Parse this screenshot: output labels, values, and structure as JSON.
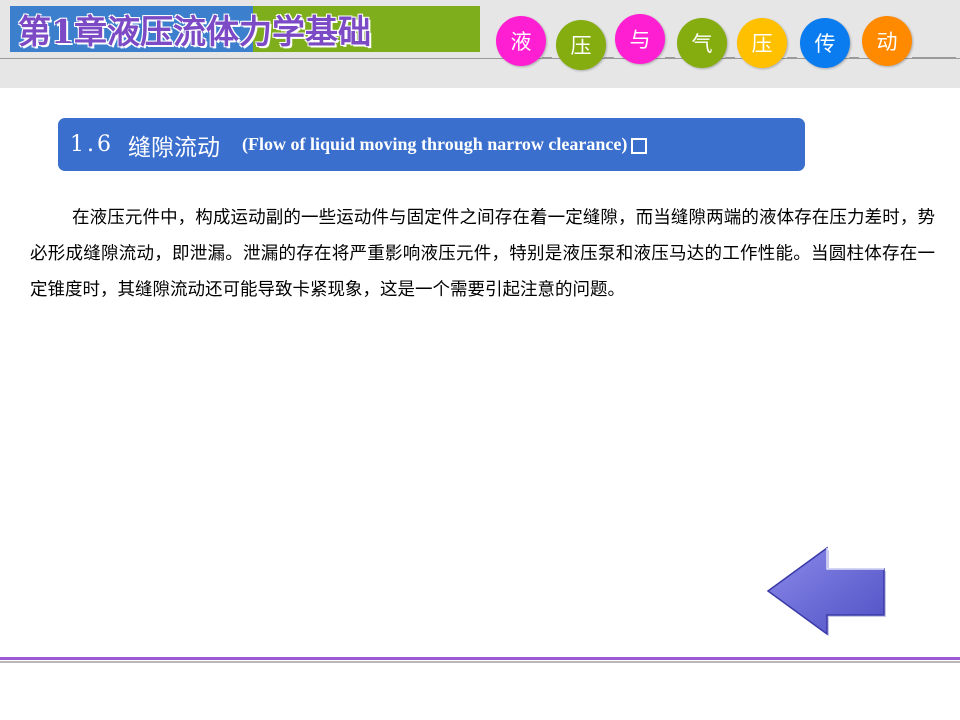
{
  "header": {
    "chapter_label": "第1章",
    "chapter_title": "液压流体力学基础",
    "course_chars": [
      {
        "char": "液",
        "color": "#ff1fd2"
      },
      {
        "char": "压",
        "color": "#85ad10"
      },
      {
        "char": "与",
        "color": "#ff1fd2"
      },
      {
        "char": "气",
        "color": "#85ad10"
      },
      {
        "char": "压",
        "color": "#ffc000"
      },
      {
        "char": "传",
        "color": "#0a7cf0"
      },
      {
        "char": "动",
        "color": "#ff8a00"
      }
    ]
  },
  "section": {
    "number": "1.6",
    "title_cn": "缝隙流动",
    "title_en": "(Flow of liquid  moving through  narrow  clearance)"
  },
  "body": {
    "paragraph": "在液压元件中，构成运动副的一些运动件与固定件之间存在着一定缝隙，而当缝隙两端的液体存在压力差时，势必形成缝隙流动，即泄漏。泄漏的存在将严重影响液压元件，特别是液压泵和液压马达的工作性能。当圆柱体存在一定锥度时，其缝隙流动还可能导致卡紧现象，这是一个需要引起注意的问题。"
  },
  "navigation": {
    "back_icon": "left-arrow-icon"
  },
  "colors": {
    "header_blue": "#3c7fcc",
    "header_green": "#7fae1c",
    "section_bar": "#3a6fce",
    "arrow_fill": "#6f6fd8",
    "footer_purple": "#9b59d6"
  }
}
